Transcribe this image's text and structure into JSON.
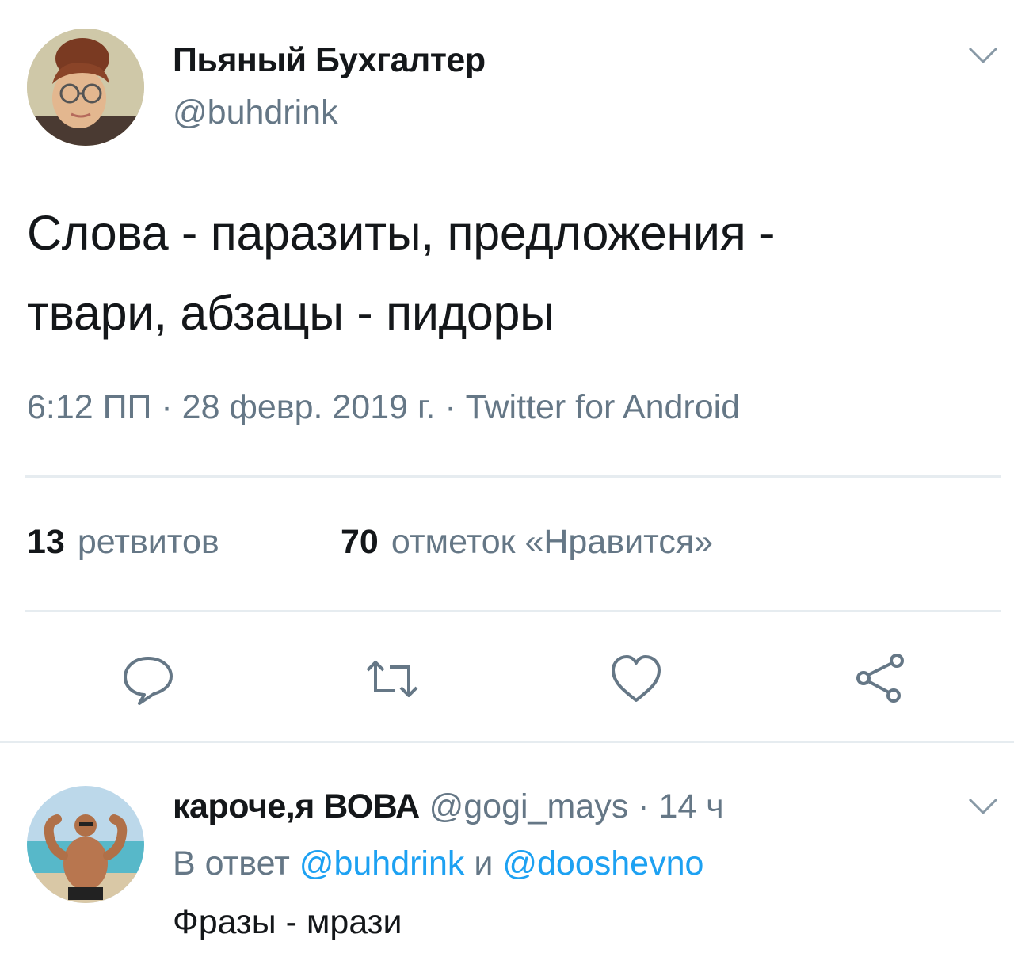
{
  "tweet": {
    "author_name": "Пьяный Бухгалтер",
    "author_handle": "@buhdrink",
    "text_line1": "Слова - паразиты, предложения -",
    "text_line2": "твари, абзацы - пидоры",
    "meta": "6:12 ПП · 28 февр. 2019 г. · Twitter for Android",
    "retweets_count": "13",
    "retweets_label": "ретвитов",
    "likes_count": "70",
    "likes_label": "отметок «Нравится»",
    "icons": {
      "menu": "chevron-down-icon",
      "reply": "reply-icon",
      "retweet": "retweet-icon",
      "like": "heart-icon",
      "share": "share-icon"
    }
  },
  "reply": {
    "author_name": "кароче,я ВОВА",
    "author_handle": "@gogi_mays",
    "separator": "·",
    "time": "14 ч",
    "reply_to_prefix": "В ответ",
    "reply_to_mention1": "@buhdrink",
    "reply_to_and": "и",
    "reply_to_mention2": "@dooshevno",
    "text": "Фразы - мрази"
  },
  "colors": {
    "text_primary": "#14171a",
    "text_secondary": "#657786",
    "accent": "#1da1f2",
    "divider": "#e6ecf0"
  }
}
